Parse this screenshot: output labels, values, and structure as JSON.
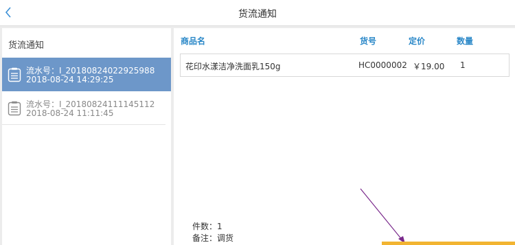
{
  "app": {
    "title": "货流通知"
  },
  "left_panel": {
    "header": "货流通知",
    "records": [
      {
        "serial": "流水号：I_20180824022925988",
        "time": "2018-08-24 14:29:25",
        "selected": true
      },
      {
        "serial": "流水号：I_20180824111145112",
        "time": "2018-08-24 11:11:45",
        "selected": false
      }
    ]
  },
  "table": {
    "columns": [
      "商品名",
      "货号",
      "定价",
      "数量"
    ],
    "rows": [
      {
        "name": "花印水漾洁净洗面乳150g",
        "code": "HC0000002",
        "price": "￥19.00",
        "qty": "1"
      }
    ]
  },
  "footer": {
    "count": "件数：1",
    "remark": "备注：调货"
  },
  "colors": {
    "accent": "#2b88c8",
    "selected_bg": "#6d97c9",
    "annotation_arrow": "#7a2a8c",
    "button": "#f2b431"
  },
  "icons": {
    "back": "chevron-left-icon",
    "record": "document-icon"
  }
}
